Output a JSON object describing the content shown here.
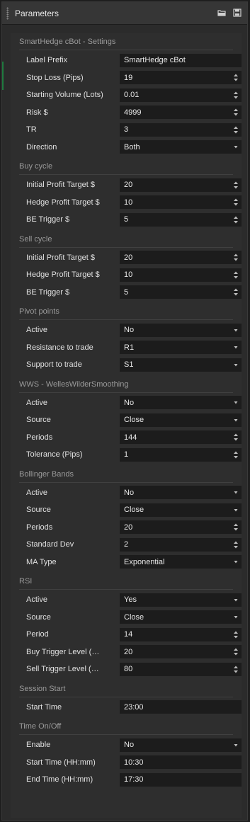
{
  "window": {
    "title": "Parameters",
    "icons": [
      "save-to-folder-icon",
      "save-icon"
    ]
  },
  "sections": [
    {
      "title": "SmartHedge cBot - Settings",
      "rows": [
        {
          "name": "label-prefix",
          "label": "Label Prefix",
          "value": "SmartHedge cBot",
          "kind": "text"
        },
        {
          "name": "stop-loss-pips",
          "label": "Stop Loss (Pips)",
          "value": "19",
          "kind": "number"
        },
        {
          "name": "starting-volume-lots",
          "label": "Starting Volume (Lots)",
          "value": "0.01",
          "kind": "number"
        },
        {
          "name": "risk",
          "label": "Risk $",
          "value": "4999",
          "kind": "number"
        },
        {
          "name": "tr",
          "label": "TR",
          "value": "3",
          "kind": "number"
        },
        {
          "name": "direction",
          "label": "Direction",
          "value": "Both",
          "kind": "select"
        }
      ]
    },
    {
      "title": "Buy cycle",
      "rows": [
        {
          "name": "buy-initial-profit-target",
          "label": "Initial Profit Target $",
          "value": "20",
          "kind": "number"
        },
        {
          "name": "buy-hedge-profit-target",
          "label": "Hedge Profit Target $",
          "value": "10",
          "kind": "number"
        },
        {
          "name": "buy-be-trigger",
          "label": "BE Trigger $",
          "value": "5",
          "kind": "number"
        }
      ]
    },
    {
      "title": "Sell cycle",
      "rows": [
        {
          "name": "sell-initial-profit-target",
          "label": "Initial Profit Target $",
          "value": "20",
          "kind": "number"
        },
        {
          "name": "sell-hedge-profit-target",
          "label": "Hedge Profit Target $",
          "value": "10",
          "kind": "number"
        },
        {
          "name": "sell-be-trigger",
          "label": "BE Trigger $",
          "value": "5",
          "kind": "number"
        }
      ]
    },
    {
      "title": "Pivot points",
      "rows": [
        {
          "name": "pivot-active",
          "label": "Active",
          "value": "No",
          "kind": "select"
        },
        {
          "name": "resistance-to-trade",
          "label": "Resistance to trade",
          "value": "R1",
          "kind": "select"
        },
        {
          "name": "support-to-trade",
          "label": "Support to trade",
          "value": "S1",
          "kind": "select"
        }
      ]
    },
    {
      "title": "WWS - WellesWilderSmoothing",
      "rows": [
        {
          "name": "wws-active",
          "label": "Active",
          "value": "No",
          "kind": "select"
        },
        {
          "name": "wws-source",
          "label": "Source",
          "value": "Close",
          "kind": "select"
        },
        {
          "name": "wws-periods",
          "label": "Periods",
          "value": "144",
          "kind": "number"
        },
        {
          "name": "wws-tolerance-pips",
          "label": "Tolerance (Pips)",
          "value": "1",
          "kind": "number"
        }
      ]
    },
    {
      "title": "Bollinger Bands",
      "rows": [
        {
          "name": "bb-active",
          "label": "Active",
          "value": "No",
          "kind": "select"
        },
        {
          "name": "bb-source",
          "label": "Source",
          "value": "Close",
          "kind": "select"
        },
        {
          "name": "bb-periods",
          "label": "Periods",
          "value": "20",
          "kind": "number"
        },
        {
          "name": "bb-standard-dev",
          "label": "Standard Dev",
          "value": "2",
          "kind": "number"
        },
        {
          "name": "bb-ma-type",
          "label": "MA Type",
          "value": "Exponential",
          "kind": "select"
        }
      ]
    },
    {
      "title": "RSI",
      "rows": [
        {
          "name": "rsi-active",
          "label": "Active",
          "value": "Yes",
          "kind": "select"
        },
        {
          "name": "rsi-source",
          "label": "Source",
          "value": "Close",
          "kind": "select"
        },
        {
          "name": "rsi-period",
          "label": "Period",
          "value": "14",
          "kind": "number"
        },
        {
          "name": "rsi-buy-trigger-level",
          "label": "Buy Trigger Level (O…",
          "value": "20",
          "kind": "number"
        },
        {
          "name": "rsi-sell-trigger-level",
          "label": "Sell Trigger Level (O…",
          "value": "80",
          "kind": "number"
        }
      ]
    },
    {
      "title": "Session Start",
      "rows": [
        {
          "name": "session-start-time",
          "label": "Start Time",
          "value": "23:00",
          "kind": "text"
        }
      ]
    },
    {
      "title": "Time On/Off",
      "rows": [
        {
          "name": "time-enable",
          "label": "Enable",
          "value": "No",
          "kind": "select"
        },
        {
          "name": "time-start-time",
          "label": "Start Time (HH:mm)",
          "value": "10:30",
          "kind": "text"
        },
        {
          "name": "time-end-time",
          "label": "End Time (HH:mm)",
          "value": "17:30",
          "kind": "text"
        }
      ]
    }
  ],
  "colors": {
    "background": "#2e2e2e",
    "field": "#1c1c1c",
    "accent": "#1f7a3f"
  }
}
